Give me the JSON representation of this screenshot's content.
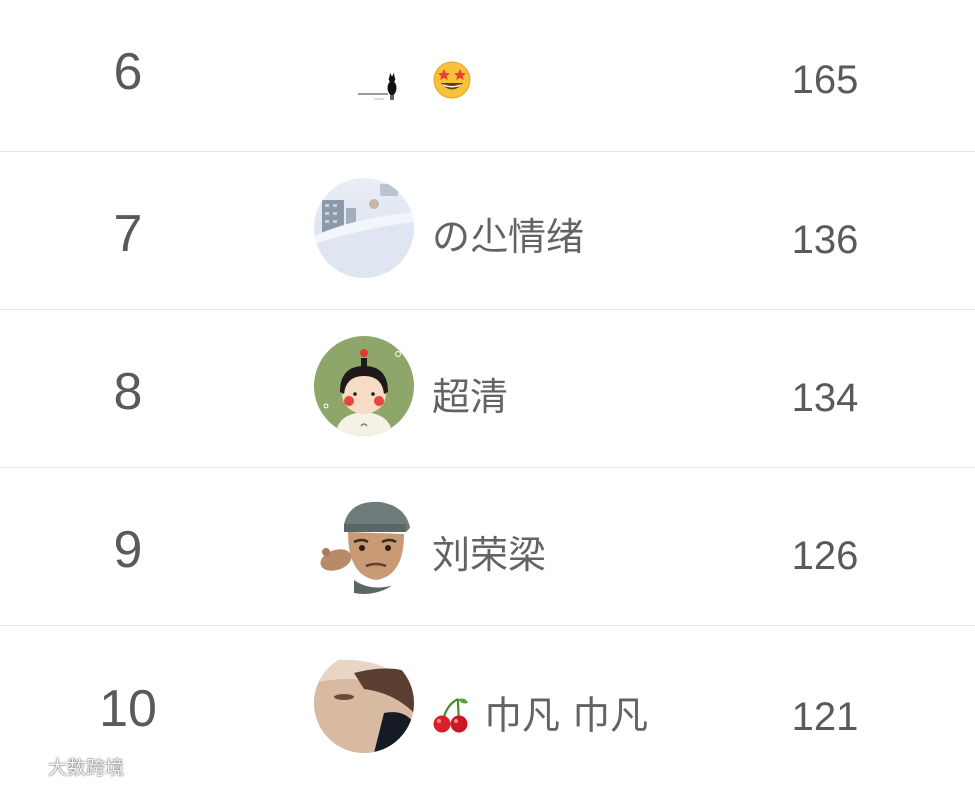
{
  "leaderboard": {
    "rows": [
      {
        "rank": "6",
        "name": "",
        "emoji": "star-struck-emoji",
        "score": "165",
        "avatar": "cat-silhouette-avatar"
      },
      {
        "rank": "7",
        "name": "の尐情绪",
        "score": "136",
        "avatar": "snow-building-avatar"
      },
      {
        "rank": "8",
        "name": "超清",
        "score": "134",
        "avatar": "cartoon-girl-avatar"
      },
      {
        "rank": "9",
        "name": "刘荣梁",
        "score": "126",
        "avatar": "cartoon-soldier-avatar"
      },
      {
        "rank": "10",
        "name": "巾凡 巾凡",
        "emoji": "cherry-emoji",
        "score": "121",
        "avatar": "face-closeup-avatar"
      }
    ]
  },
  "watermark": {
    "text": "大数跨境",
    "logo": "watermark-logo-icon"
  }
}
